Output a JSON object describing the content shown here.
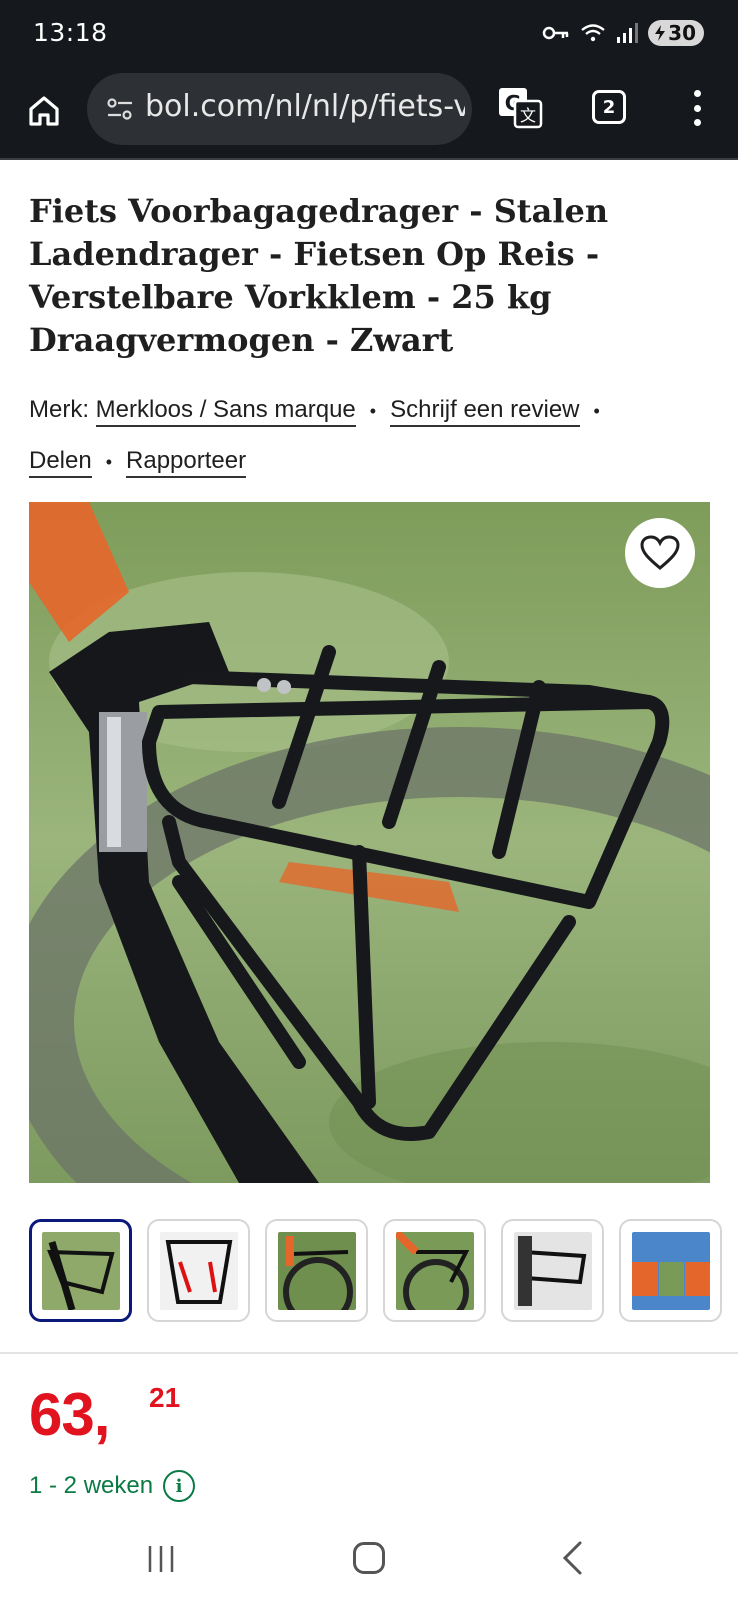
{
  "status_bar": {
    "time": "13:18",
    "battery": "30",
    "icons": [
      "key-icon",
      "wifi-icon",
      "signal-icon",
      "battery-icon"
    ]
  },
  "browser": {
    "url": "bol.com/nl/nl/p/fiets-v",
    "tab_count": "2",
    "icons": [
      "home-icon",
      "site-settings-icon",
      "translate-icon",
      "more-icon"
    ]
  },
  "product": {
    "title": "Fiets Voorbagagedrager - Stalen Ladendrager - Fietsen Op Reis - Verstelbare Vorkklem - 25 kg Draagvermogen - Zwart",
    "brand_label": "Merk:",
    "brand": "Merkloos / Sans marque",
    "review_link": "Schrijf een review",
    "share_link": "Delen",
    "report_link": "Rapporteer",
    "price_main": "63,",
    "price_cents": "21",
    "delivery": "1 - 2 weken"
  },
  "thumbnails": [
    {
      "name": "thumb-1",
      "active": true
    },
    {
      "name": "thumb-2",
      "active": false
    },
    {
      "name": "thumb-3",
      "active": false
    },
    {
      "name": "thumb-4",
      "active": false
    },
    {
      "name": "thumb-5",
      "active": false
    },
    {
      "name": "thumb-6",
      "active": false
    }
  ],
  "colors": {
    "price": "#e0131f",
    "delivery": "#0b7a44",
    "active_thumb": "#0b1a7a",
    "toolbar": "#15181c"
  }
}
